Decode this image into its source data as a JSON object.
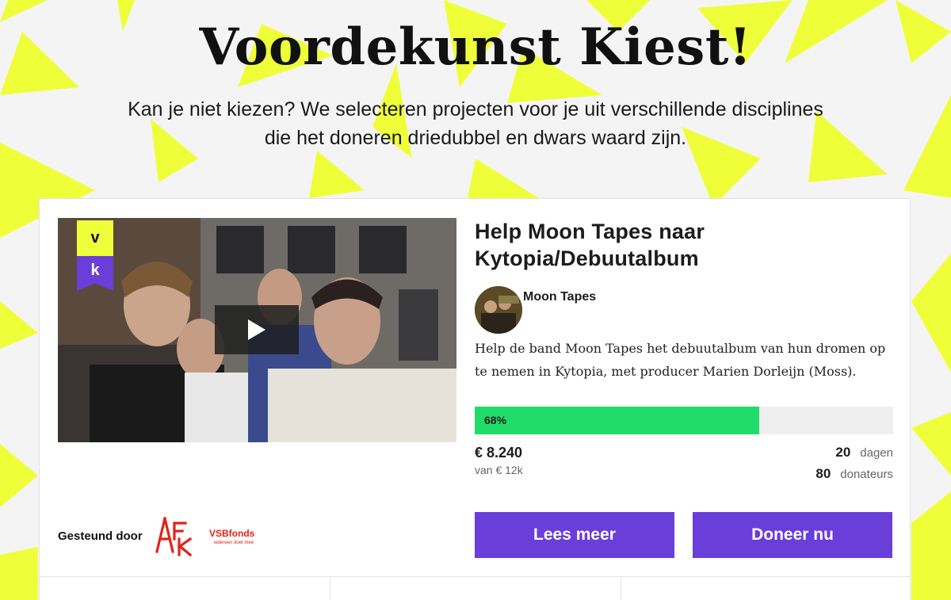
{
  "hero": {
    "title": "Voordekunst Kiest!",
    "subtitle_line1": "Kan je niet kiezen? We selecteren projecten voor je uit verschillende disciplines",
    "subtitle_line2": "die het doneren driedubbel en dwars waard zijn."
  },
  "project": {
    "badge_v": "v",
    "badge_k": "k",
    "title": "Help Moon Tapes naar Kytopia/Debuutalbum",
    "owner": "Moon Tapes",
    "description": "Help de band Moon Tapes het debuutalbum van hun dromen op te nemen in Kytopia, met producer Marien Dorleijn (Moss).",
    "progress": 0.68,
    "progress_label": "68%",
    "amount": "€ 8.240",
    "goal": "van € 12k",
    "days_value": "20",
    "days_label": "dagen",
    "donors_value": "80",
    "donors_label": "donateurs",
    "read_more": "Lees meer",
    "donate": "Doneer nu"
  },
  "supported": {
    "label": "Gesteund door",
    "sponsors": [
      "AFK",
      "VSBfonds"
    ]
  },
  "colors": {
    "accent_purple": "#6a3ed8",
    "progress_green": "#22dc6a",
    "highlight_yellow": "#eeff3a"
  }
}
